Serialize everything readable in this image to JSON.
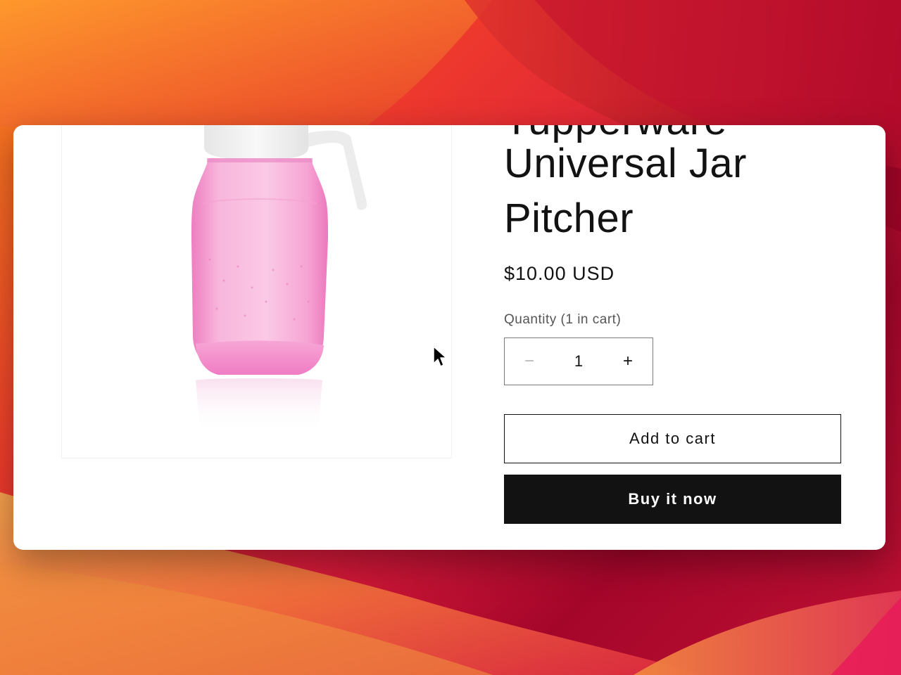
{
  "product": {
    "title_cutoff": "Tupperware",
    "title": "Universal Jar Pitcher",
    "price": "$10.00 USD"
  },
  "quantity": {
    "label": "Quantity (1 in cart)",
    "value": "1",
    "decrease_symbol": "−",
    "increase_symbol": "+"
  },
  "buttons": {
    "add_to_cart": "Add to cart",
    "buy_now": "Buy it now"
  },
  "icons": {
    "product_image": "pink-jar-pitcher-image",
    "cursor": "mouse-pointer-icon"
  },
  "colors": {
    "text": "#121212",
    "buy_button_bg": "#121212",
    "jar_pink": "#f48fc6",
    "lid_white": "#f1f1f1"
  }
}
